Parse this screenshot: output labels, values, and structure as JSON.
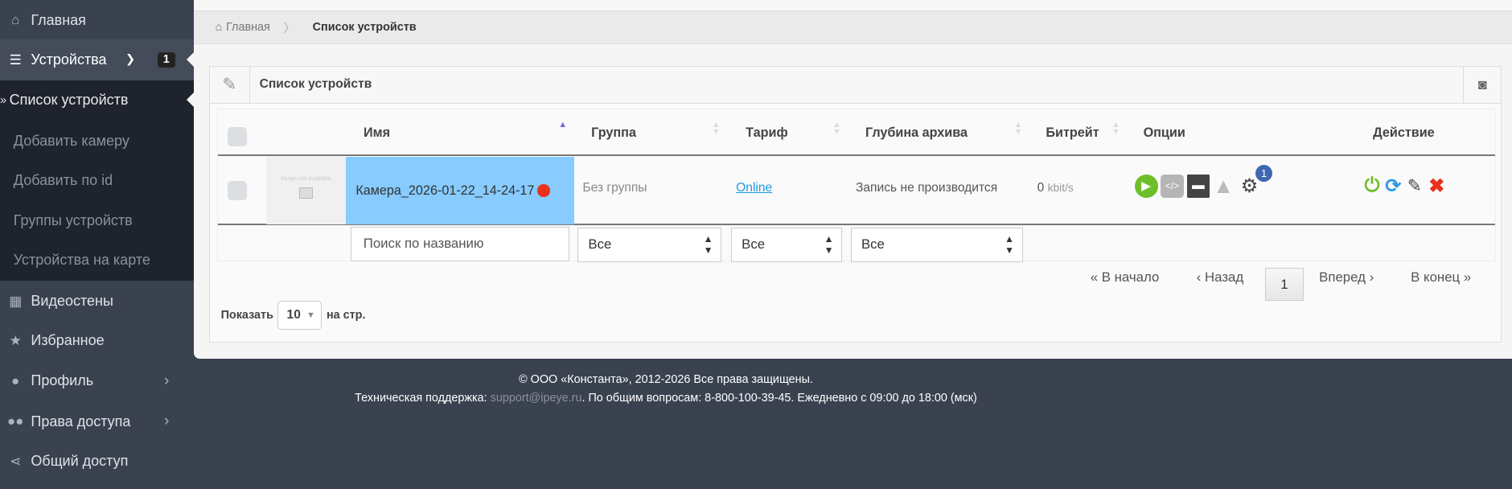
{
  "sidebar": {
    "items": [
      {
        "label": "Главная",
        "icon": "home-icon"
      },
      {
        "label": "Устройства",
        "icon": "list-icon",
        "badge": "1"
      },
      {
        "label": "Видеостены",
        "icon": "grid-icon"
      },
      {
        "label": "Избранное",
        "icon": "star-icon"
      },
      {
        "label": "Профиль",
        "icon": "user-icon"
      },
      {
        "label": "Права доступа",
        "icon": "users-icon"
      },
      {
        "label": "Общий доступ",
        "icon": "share-icon"
      }
    ],
    "submenu": [
      "Список устройств",
      "Добавить камеру",
      "Добавить по id",
      "Группы устройств",
      "Устройства на карте"
    ]
  },
  "breadcrumb": {
    "home": "Главная",
    "current": "Список устройств"
  },
  "panel": {
    "title": "Список устройств"
  },
  "table": {
    "headers": [
      "Имя",
      "Группа",
      "Тариф",
      "Глубина архива",
      "Битрейт",
      "Опции",
      "Действие"
    ],
    "rows": [
      {
        "thumb": "Image not available",
        "name": "Камера_2026-01-22_14-24-17",
        "group": "Без группы",
        "tariff": "Online",
        "archive": "Запись не производится",
        "bitrate": "0",
        "bitrate_unit": "kbit/s",
        "settings_badge": "1"
      }
    ],
    "filters": {
      "search_placeholder": "Поиск по названию",
      "group": "Все",
      "tariff": "Все",
      "archive": "Все"
    }
  },
  "pagination": {
    "first": "В начало",
    "prev": "Назад",
    "page": "1",
    "next": "Вперед",
    "last": "В конец"
  },
  "page_size": {
    "label": "Показать",
    "value": "10",
    "suffix": "на стр."
  },
  "footer": {
    "copyright": "© ООО «Константа», 2012-2026 Все права защищены.",
    "support_label": "Техническая поддержка:",
    "support_email": "support@ipeye.ru",
    "contacts": ". По общим вопросам: 8-800-100-39-45. Ежедневно с 09:00 до 18:00 (мск)"
  },
  "colors": {
    "highlight": "#87cbff",
    "sidebar": "#3a4250",
    "submenu": "#1e232d",
    "link": "#1e9be0"
  }
}
